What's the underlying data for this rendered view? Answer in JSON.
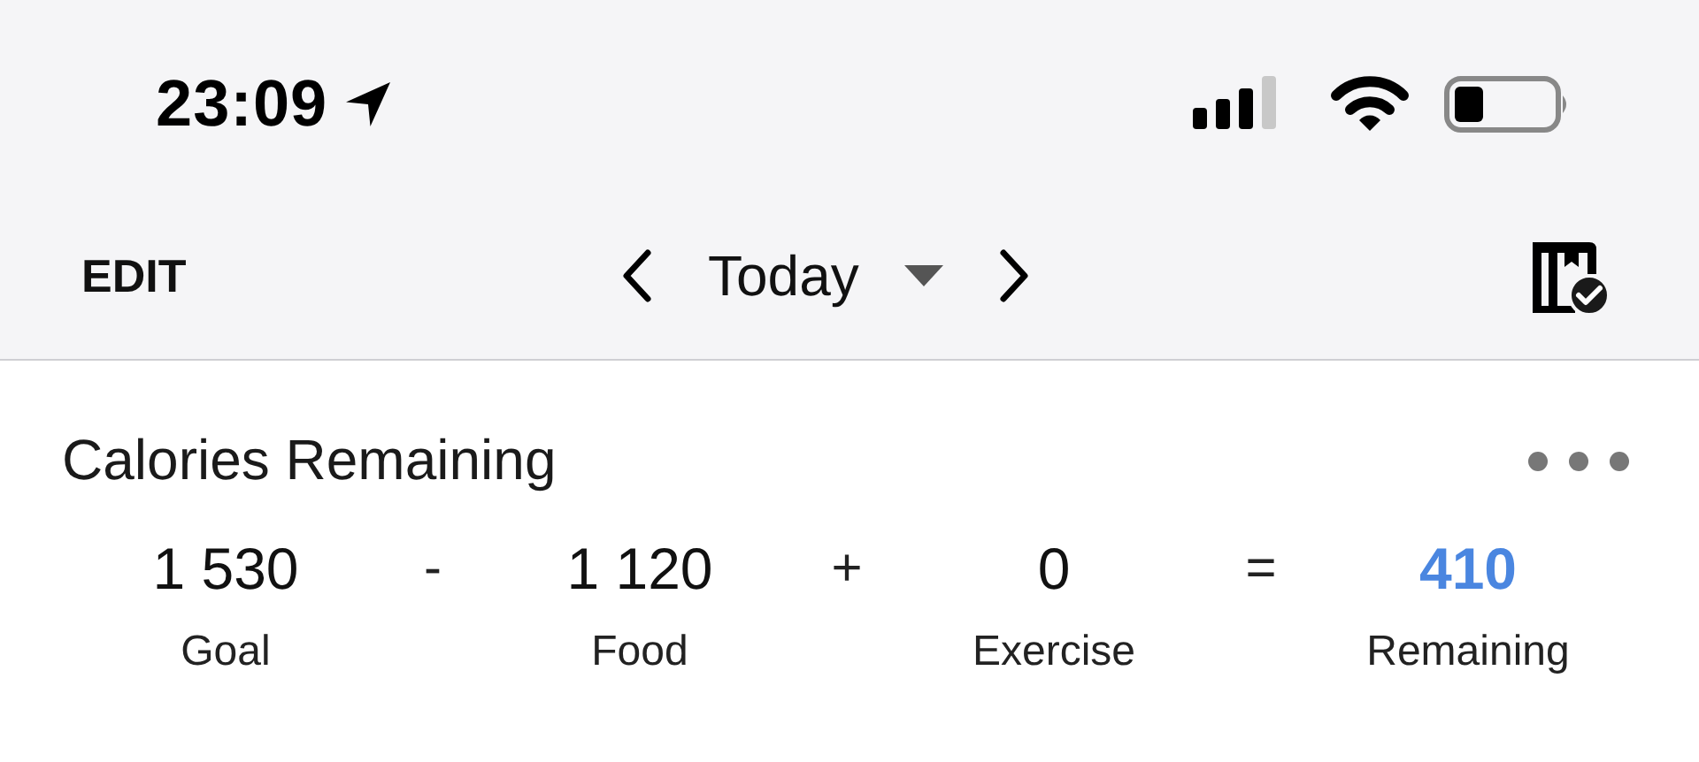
{
  "status_bar": {
    "time": "23:09"
  },
  "nav": {
    "edit": "EDIT",
    "title": "Today"
  },
  "card": {
    "title": "Calories Remaining",
    "summary": [
      {
        "kind": "term",
        "value": "1 530",
        "label": "Goal",
        "highlight": false
      },
      {
        "kind": "operator",
        "symbol": "-"
      },
      {
        "kind": "term",
        "value": "1 120",
        "label": "Food",
        "highlight": false
      },
      {
        "kind": "operator",
        "symbol": "+"
      },
      {
        "kind": "term",
        "value": "0",
        "label": "Exercise",
        "highlight": false
      },
      {
        "kind": "operator",
        "symbol": "="
      },
      {
        "kind": "term",
        "value": "410",
        "label": "Remaining",
        "highlight": true
      }
    ]
  }
}
